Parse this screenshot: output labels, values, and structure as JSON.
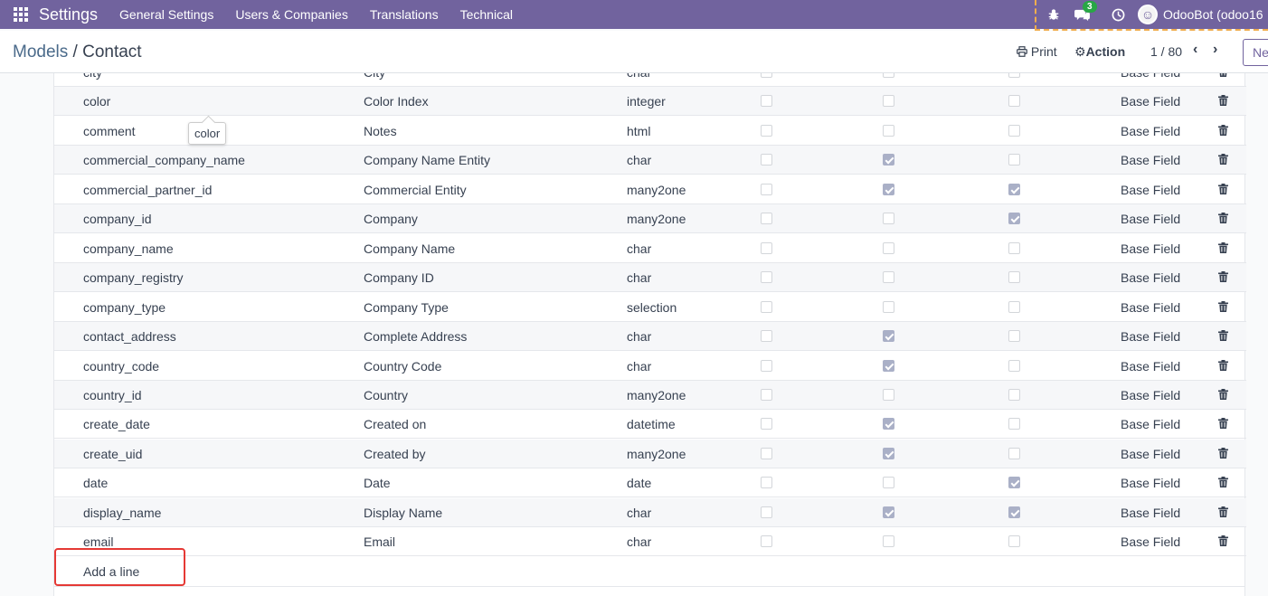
{
  "navbar": {
    "brand": "Settings",
    "menu": [
      "General Settings",
      "Users & Companies",
      "Translations",
      "Technical"
    ],
    "messages_count": "3",
    "user": "OdooBot (odoo16"
  },
  "control_panel": {
    "breadcrumb_parent": "Models",
    "breadcrumb_separator": "/",
    "breadcrumb_current": "Contact",
    "print_label": "Print",
    "action_label": "Action",
    "pager": "1 / 80",
    "new_label": "Ne"
  },
  "tooltip": "color",
  "rows": [
    {
      "name": "city",
      "label": "City",
      "type": "char",
      "c1": false,
      "c2": false,
      "c3": false,
      "source": "Base Field"
    },
    {
      "name": "color",
      "label": "Color Index",
      "type": "integer",
      "c1": false,
      "c2": false,
      "c3": false,
      "source": "Base Field"
    },
    {
      "name": "comment",
      "label": "Notes",
      "type": "html",
      "c1": false,
      "c2": false,
      "c3": false,
      "source": "Base Field"
    },
    {
      "name": "commercial_company_name",
      "label": "Company Name Entity",
      "type": "char",
      "c1": false,
      "c2": true,
      "c3": false,
      "source": "Base Field"
    },
    {
      "name": "commercial_partner_id",
      "label": "Commercial Entity",
      "type": "many2one",
      "c1": false,
      "c2": true,
      "c3": true,
      "source": "Base Field"
    },
    {
      "name": "company_id",
      "label": "Company",
      "type": "many2one",
      "c1": false,
      "c2": false,
      "c3": true,
      "source": "Base Field"
    },
    {
      "name": "company_name",
      "label": "Company Name",
      "type": "char",
      "c1": false,
      "c2": false,
      "c3": false,
      "source": "Base Field"
    },
    {
      "name": "company_registry",
      "label": "Company ID",
      "type": "char",
      "c1": false,
      "c2": false,
      "c3": false,
      "source": "Base Field"
    },
    {
      "name": "company_type",
      "label": "Company Type",
      "type": "selection",
      "c1": false,
      "c2": false,
      "c3": false,
      "source": "Base Field"
    },
    {
      "name": "contact_address",
      "label": "Complete Address",
      "type": "char",
      "c1": false,
      "c2": true,
      "c3": false,
      "source": "Base Field"
    },
    {
      "name": "country_code",
      "label": "Country Code",
      "type": "char",
      "c1": false,
      "c2": true,
      "c3": false,
      "source": "Base Field"
    },
    {
      "name": "country_id",
      "label": "Country",
      "type": "many2one",
      "c1": false,
      "c2": false,
      "c3": false,
      "source": "Base Field"
    },
    {
      "name": "create_date",
      "label": "Created on",
      "type": "datetime",
      "c1": false,
      "c2": true,
      "c3": false,
      "source": "Base Field"
    },
    {
      "name": "create_uid",
      "label": "Created by",
      "type": "many2one",
      "c1": false,
      "c2": true,
      "c3": false,
      "source": "Base Field"
    },
    {
      "name": "date",
      "label": "Date",
      "type": "date",
      "c1": false,
      "c2": false,
      "c3": true,
      "source": "Base Field"
    },
    {
      "name": "display_name",
      "label": "Display Name",
      "type": "char",
      "c1": false,
      "c2": true,
      "c3": true,
      "source": "Base Field"
    },
    {
      "name": "email",
      "label": "Email",
      "type": "char",
      "c1": false,
      "c2": false,
      "c3": false,
      "source": "Base Field"
    }
  ],
  "add_line_label": "Add a line"
}
